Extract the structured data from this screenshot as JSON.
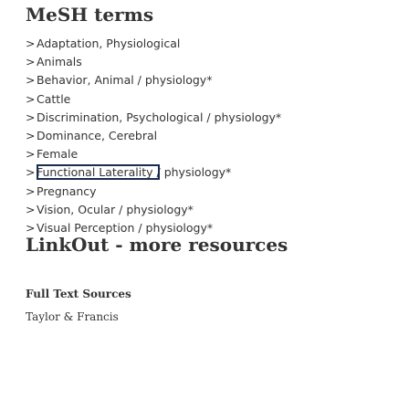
{
  "mesh": {
    "title": "MeSH terms",
    "chevron": ">",
    "terms": [
      "Adaptation, Physiological",
      "Animals",
      "Behavior, Animal / physiology*",
      "Cattle",
      "Discrimination, Psychological / physiology*",
      "Dominance, Cerebral",
      "Female",
      "Functional Laterality / physiology*",
      "Pregnancy",
      "Vision, Ocular / physiology*",
      "Visual Perception / physiology*"
    ]
  },
  "linkout": {
    "title": "LinkOut - more resources",
    "full_text_heading": "Full Text Sources",
    "provider": "Taylor & Francis"
  },
  "colors": {
    "text": "#333333",
    "highlight_border": "#1b2d4f"
  }
}
